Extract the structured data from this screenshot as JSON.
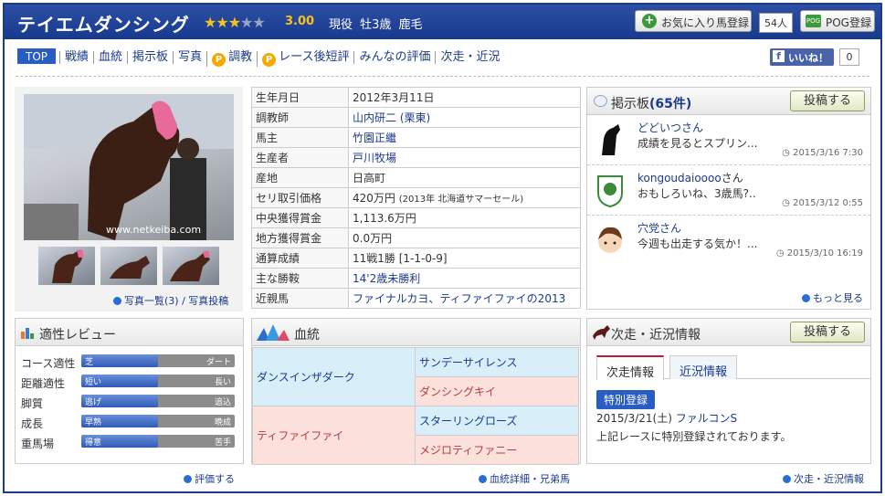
{
  "header": {
    "horse_name": "テイエムダンシング",
    "rating": "3.00",
    "stars": [
      1,
      1,
      1,
      0,
      0
    ],
    "status": "現役 牡3歳 鹿毛",
    "fav_label": "お気に入り馬登録",
    "fav_count": "54人",
    "pog_label": "POG登録",
    "pog_icon_text": "POG"
  },
  "nav": {
    "items": [
      "TOP",
      "戦績",
      "血統",
      "掲示板",
      "写真",
      "調教",
      "レース後短評",
      "みんなの評価",
      "次走・近況"
    ],
    "p_icon": "P",
    "fb_label": "いいね！",
    "fb_count": "0"
  },
  "photo": {
    "links": "写真一覧(3) / 写真投稿",
    "watermark": "www.netkeiba.com"
  },
  "info": [
    {
      "k": "生年月日",
      "v": "2012年3月11日"
    },
    {
      "k": "調教師",
      "v": "山内研二 (栗東)"
    },
    {
      "k": "馬主",
      "v": "竹園正繼"
    },
    {
      "k": "生産者",
      "v": "戸川牧場"
    },
    {
      "k": "産地",
      "v": "日高町"
    },
    {
      "k": "セリ取引価格",
      "v": "420万円",
      "v_note": "(2013年 北海道サマーセール)"
    },
    {
      "k": "中央獲得賞金",
      "v": "1,113.6万円"
    },
    {
      "k": "地方獲得賞金",
      "v": "0.0万円"
    },
    {
      "k": "通算成績",
      "v": "11戦1勝 [1-1-0-9]"
    },
    {
      "k": "主な勝鞍",
      "v": "14'2歳未勝利"
    },
    {
      "k": "近親馬",
      "v": "ファイナルカヨ、ティファイファイの2013"
    }
  ],
  "bbs": {
    "title": "掲示板",
    "count_text": "(65件)",
    "post_label": "投稿する",
    "more": "もっと見る",
    "items": [
      {
        "user": "どどいつさん",
        "text": "成績を見るとスプリン...",
        "time": "2015/3/16 7:30"
      },
      {
        "user": "kongoudaioooo",
        "user_suffix": "さん",
        "text": "おもしろいね、3歳馬?..",
        "time": "2015/3/12 0:55"
      },
      {
        "user": "穴党さん",
        "text": "今週も出走する気か！...",
        "time": "2015/3/10 16:19"
      }
    ]
  },
  "aptitude": {
    "title": "適性レビュー",
    "link": "評価する",
    "rows": [
      {
        "label": "コース適性",
        "left": "芝",
        "right": "ダート",
        "fill": 0.5
      },
      {
        "label": "距離適性",
        "left": "短い",
        "right": "長い",
        "fill": 0.5
      },
      {
        "label": "脚質",
        "left": "逃げ",
        "right": "追込",
        "fill": 0.5
      },
      {
        "label": "成長",
        "left": "早熟",
        "right": "晩成",
        "fill": 0.5
      },
      {
        "label": "重馬場",
        "left": "得意",
        "right": "苦手",
        "fill": 0.5
      }
    ]
  },
  "pedigree": {
    "title": "血統",
    "link": "血統詳細・兄弟馬",
    "sire": "ダンスインザダーク",
    "sire_sire": "サンデーサイレンス",
    "sire_dam": "ダンシングキイ",
    "dam": "ティファイファイ",
    "dam_sire": "スターリングローズ",
    "dam_dam": "メジロティファニー"
  },
  "next": {
    "title": "次走・近況情報",
    "post_label": "投稿する",
    "tab1": "次走情報",
    "tab2": "近況情報",
    "badge": "特別登録",
    "date": "2015/3/21(土)",
    "race": "ファルコンS",
    "desc": "上記レースに特別登録されております。",
    "link": "次走・近況情報"
  }
}
